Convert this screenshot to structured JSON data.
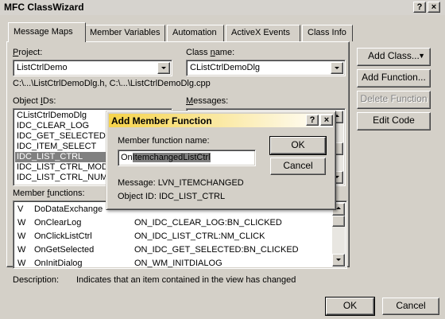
{
  "window": {
    "title": "MFC ClassWizard",
    "help_btn": "?",
    "close_btn": "×"
  },
  "tabs": [
    {
      "label": "Message Maps",
      "active": true
    },
    {
      "label": "Member Variables"
    },
    {
      "label": "Automation"
    },
    {
      "label": "ActiveX Events"
    },
    {
      "label": "Class Info"
    }
  ],
  "project": {
    "label_prefix": "",
    "label_ul": "P",
    "label_rest": "roject:",
    "value": "ListCtrlDemo"
  },
  "class_name": {
    "label_prefix": "Class ",
    "label_ul": "n",
    "label_rest": "ame:",
    "value": "CListCtrlDemoDlg"
  },
  "file_paths": "C:\\...\\ListCtrlDemoDlg.h, C:\\...\\ListCtrlDemoDlg.cpp",
  "object_ids": {
    "label_prefix": "Object ",
    "label_ul": "I",
    "label_rest": "Ds:",
    "items": [
      "CListCtrlDemoDlg",
      "IDC_CLEAR_LOG",
      "IDC_GET_SELECTED",
      "IDC_ITEM_SELECT",
      "IDC_LIST_CTRL",
      "IDC_LIST_CTRL_MODE",
      "IDC_LIST_CTRL_NUMI"
    ],
    "selected_index": 4
  },
  "messages": {
    "label_prefix": "",
    "label_ul": "M",
    "label_rest": "essages:"
  },
  "member_functions": {
    "label_prefix": "Member ",
    "label_ul": "f",
    "label_rest": "unctions:",
    "rows": [
      {
        "type": "V",
        "name": "DoDataExchange",
        "handler": ""
      },
      {
        "type": "W",
        "name": "OnClearLog",
        "handler": "ON_IDC_CLEAR_LOG:BN_CLICKED"
      },
      {
        "type": "W",
        "name": "OnClickListCtrl",
        "handler": "ON_IDC_LIST_CTRL:NM_CLICK"
      },
      {
        "type": "W",
        "name": "OnGetSelected",
        "handler": "ON_IDC_GET_SELECTED:BN_CLICKED"
      },
      {
        "type": "W",
        "name": "OnInitDialog",
        "handler": "ON_WM_INITDIALOG"
      }
    ]
  },
  "description": {
    "label": "Description:",
    "text": "Indicates that an item contained in the view has changed"
  },
  "side_buttons": {
    "add_class": "Add Class...",
    "add_class_arrow": "▼",
    "add_function": "Add Function...",
    "delete_function": "Delete Function",
    "edit_code": "Edit Code"
  },
  "footer": {
    "ok": "OK",
    "cancel": "Cancel"
  },
  "dialog": {
    "title": "Add Member Function",
    "help_btn": "?",
    "close_btn": "×",
    "name_label": "Member function name:",
    "name_value": "OnItemchangedListCtrl",
    "name_value_pre": "On",
    "name_value_sel": "ItemchangedListCtrl",
    "message_line": "Message: LVN_ITEMCHANGED",
    "object_line": "Object ID: IDC_LIST_CTRL",
    "ok": "OK",
    "cancel": "Cancel"
  }
}
